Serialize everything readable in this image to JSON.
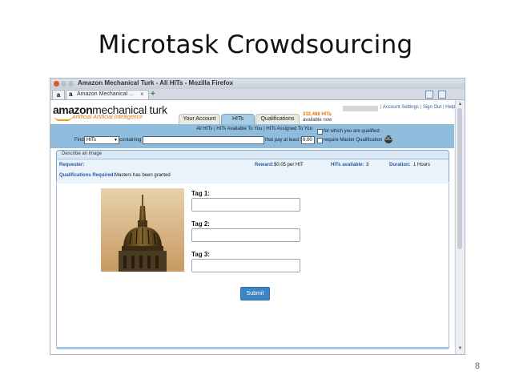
{
  "slide": {
    "title": "Microtask Crowdsourcing",
    "page_number": "8"
  },
  "browser": {
    "window_title": "Amazon Mechanical Turk - All HITs - Mozilla Firefox",
    "first_tab_icon": "a",
    "tab_title": "Amazon Mechanical ...",
    "tab_close": "×",
    "new_tab": "+",
    "download_icon": "download-arrow-icon",
    "scroll_up": "▲",
    "scroll_down": "▼"
  },
  "mturk": {
    "logo_amazon": "amazon",
    "logo_mt": "mechanical turk",
    "logo_tagline": "Artificial Artificial Intelligence",
    "nav_tabs": [
      "Your Account",
      "HITs",
      "Qualifications"
    ],
    "hits_available_count": "332,488 HITs",
    "hits_available_sub": "available now",
    "account_links": [
      "Account Settings",
      "Sign Out",
      "Help"
    ],
    "sublinks": [
      "All HITs",
      "HITs Available To You",
      "HITs Assigned To You"
    ],
    "search": {
      "find_label": "Find",
      "find_select": "HITs",
      "containing_label": "containing",
      "search_value": "",
      "pay_label": "that pay at least $",
      "pay_value": "0.00",
      "qualified_label": "for which you are qualified",
      "master_label": "require Master Qualification",
      "go_label": "GO"
    },
    "hit": {
      "title": "Describe an image",
      "requester_label": "Requester:",
      "requester_value": "",
      "reward_label": "Reward:",
      "reward_value": "$0.05 per HIT",
      "hits_available_label": "HITs available:",
      "hits_available_value": "3",
      "duration_label": "Duration:",
      "duration_value": "1 Hours",
      "qual_label": "Qualifications Required:",
      "qual_value": "Masters  has been granted"
    },
    "form": {
      "tags": [
        {
          "label": "Tag 1:",
          "value": ""
        },
        {
          "label": "Tag 2:",
          "value": ""
        },
        {
          "label": "Tag 3:",
          "value": ""
        }
      ],
      "submit_label": "Submit"
    }
  },
  "colors": {
    "accent_blue": "#8fbcdc",
    "submit_blue": "#3d86c6",
    "amazon_orange": "#e47911"
  }
}
